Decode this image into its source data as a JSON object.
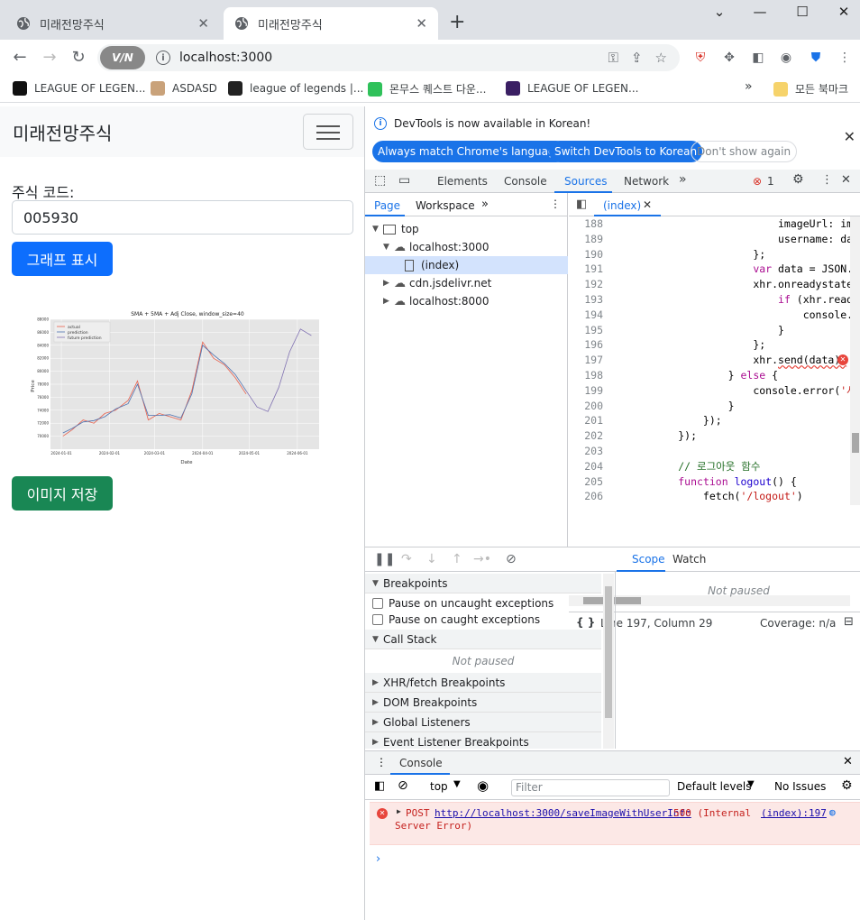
{
  "browser": {
    "tabs": [
      {
        "title": "미래전망주식",
        "active": false
      },
      {
        "title": "미래전망주식",
        "active": true
      }
    ],
    "url": "localhost:3000",
    "vpn_label": "V/N",
    "bookmarks": [
      {
        "label": "LEAGUE OF LEGEN...",
        "color": "#111"
      },
      {
        "label": "ASDASD",
        "color": "#c9a27a"
      },
      {
        "label": "league of legends |...",
        "color": "#222"
      },
      {
        "label": "몬무스 퀘스트 다운...",
        "color": "#2fc15a"
      },
      {
        "label": "LEAGUE OF LEGEN...",
        "color": "#3a1f63"
      }
    ],
    "bookmarks_folder": "모든 북마크",
    "bookmarks_more": "»"
  },
  "page": {
    "brand": "미래전망주식",
    "code_label": "주식 코드:",
    "code_value": "005930",
    "graph_button": "그래프 표시",
    "save_button": "이미지 저장"
  },
  "chart_data": {
    "type": "line",
    "title": "SMA + 5MA + Adj Close, window_size=40",
    "xlabel": "Date",
    "ylabel": "Price",
    "ylim": [
      68000,
      88000
    ],
    "yticks": [
      "70000",
      "72000",
      "74000",
      "76000",
      "78000",
      "80000",
      "82000",
      "84000",
      "86000",
      "88000"
    ],
    "xticks": [
      "2024-01-01",
      "2024-02-01",
      "2024-03-01",
      "2024-04-01",
      "2024-05-01",
      "2024-06-01"
    ],
    "legend": [
      "actual",
      "prediction",
      "future prediction"
    ],
    "legend_position": "top-left",
    "colors": {
      "actual": "#e8604c",
      "prediction": "#4c72b0",
      "future": "#8172b2",
      "background": "#e5e5e5"
    },
    "series": [
      {
        "name": "actual",
        "x": [
          "2024-01-02",
          "2024-01-08",
          "2024-01-15",
          "2024-01-22",
          "2024-01-29",
          "2024-02-05",
          "2024-02-13",
          "2024-02-19",
          "2024-02-26",
          "2024-03-04",
          "2024-03-11",
          "2024-03-18",
          "2024-03-25",
          "2024-04-01",
          "2024-04-08",
          "2024-04-15",
          "2024-04-22",
          "2024-04-29"
        ],
        "values": [
          70000,
          71000,
          72500,
          72000,
          73500,
          74000,
          75500,
          78500,
          72500,
          73500,
          73000,
          72500,
          77000,
          84500,
          82000,
          81000,
          79000,
          76500
        ]
      },
      {
        "name": "prediction",
        "x": [
          "2024-01-02",
          "2024-01-08",
          "2024-01-15",
          "2024-01-22",
          "2024-01-29",
          "2024-02-05",
          "2024-02-13",
          "2024-02-19",
          "2024-02-26",
          "2024-03-04",
          "2024-03-11",
          "2024-03-18",
          "2024-03-25",
          "2024-04-01",
          "2024-04-08",
          "2024-04-15",
          "2024-04-22",
          "2024-04-29"
        ],
        "values": [
          70500,
          71200,
          72200,
          72400,
          73000,
          74200,
          75000,
          78000,
          73200,
          73200,
          73300,
          72800,
          76500,
          84000,
          82500,
          81200,
          79500,
          77000
        ]
      },
      {
        "name": "future prediction",
        "x": [
          "2024-04-29",
          "2024-05-06",
          "2024-05-13",
          "2024-05-20",
          "2024-05-27",
          "2024-06-03",
          "2024-06-10"
        ],
        "values": [
          77000,
          74500,
          73800,
          77500,
          83000,
          86500,
          85500
        ]
      }
    ]
  },
  "devtools": {
    "infobar": {
      "message": "DevTools is now available in Korean!",
      "btn_match": "Always match Chrome's language",
      "btn_switch": "Switch DevTools to Korean",
      "btn_dont": "Don't show again"
    },
    "tabs": [
      "Elements",
      "Console",
      "Sources",
      "Network"
    ],
    "selected_tab": "Sources",
    "error_count": "1",
    "nav": {
      "subtabs": [
        "Page",
        "Workspace"
      ],
      "tree": [
        {
          "label": "top",
          "indent": 0,
          "icon": "frame"
        },
        {
          "label": "localhost:3000",
          "indent": 1,
          "icon": "cloud"
        },
        {
          "label": "(index)",
          "indent": 2,
          "icon": "file",
          "selected": true
        },
        {
          "label": "cdn.jsdelivr.net",
          "indent": 1,
          "icon": "cloud"
        },
        {
          "label": "localhost:8000",
          "indent": 1,
          "icon": "cloud"
        }
      ]
    },
    "editor": {
      "file_tab": "(index)",
      "status_position": "Line 197, Column 29",
      "coverage": "Coverage: n/a",
      "lines": [
        {
          "n": "188",
          "html": "                          imageUrl: imgU"
        },
        {
          "n": "189",
          "html": "                          username: data"
        },
        {
          "n": "190",
          "html": "                      };"
        },
        {
          "n": "191",
          "html": "                      <span class='kw'>var</span> data = JSON.st"
        },
        {
          "n": "192",
          "html": "                      xhr.onreadystatech"
        },
        {
          "n": "193",
          "html": "                          <span class='kw'>if</span> (xhr.readyS"
        },
        {
          "n": "194",
          "html": "                              console.lo"
        },
        {
          "n": "195",
          "html": "                          }"
        },
        {
          "n": "196",
          "html": "                      };"
        },
        {
          "n": "197",
          "html": "                      xhr.<span class='err-underline'>send(data);</span>"
        },
        {
          "n": "198",
          "html": "                  } <span class='kw'>else</span> {"
        },
        {
          "n": "199",
          "html": "                      console.error(<span class='str'>'사용</span>"
        },
        {
          "n": "200",
          "html": "                  }"
        },
        {
          "n": "201",
          "html": "              });"
        },
        {
          "n": "202",
          "html": "          });"
        },
        {
          "n": "203",
          "html": ""
        },
        {
          "n": "204",
          "html": "          <span class='cm'>// 로그아웃 함수</span>"
        },
        {
          "n": "205",
          "html": "          <span class='kw'>function</span> <span class='fn'>logout</span>() {"
        },
        {
          "n": "206",
          "html": "              fetch(<span class='str'>'/logout'</span>)"
        }
      ]
    },
    "debugger": {
      "breakpoints_header": "Breakpoints",
      "pause_uncaught": "Pause on uncaught exceptions",
      "pause_caught": "Pause on caught exceptions",
      "callstack_header": "Call Stack",
      "not_paused": "Not paused",
      "sections": [
        "XHR/fetch Breakpoints",
        "DOM Breakpoints",
        "Global Listeners",
        "Event Listener Breakpoints"
      ],
      "scope_tab": "Scope",
      "watch_tab": "Watch",
      "scope_not_paused": "Not paused"
    },
    "console": {
      "tab": "Console",
      "context": "top",
      "filter_placeholder": "Filter",
      "levels": "Default levels",
      "issues": "No Issues",
      "error_method": "POST",
      "error_url": "http://localhost:3000/saveImageWithUserInfo",
      "error_status": "500 (Internal",
      "error_status2": "Server Error)",
      "error_source": "(index):197"
    }
  }
}
